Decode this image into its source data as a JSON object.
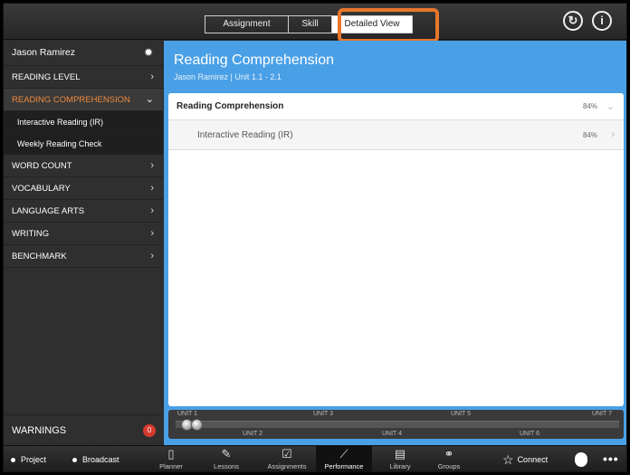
{
  "topbar": {
    "tabs": [
      "Assignment",
      "Skill",
      "Detailed View"
    ],
    "selected_tab": "Detailed View",
    "refresh_icon": "refresh-icon",
    "info_icon": "info-icon",
    "highlight_color": "#e8762c"
  },
  "sidebar": {
    "user_name": "Jason Ramirez",
    "settings_icon": "gear-icon",
    "items": [
      {
        "label": "READING LEVEL",
        "icon": "chevron-right-icon"
      },
      {
        "label": "READING COMPREHENSION",
        "icon": "chevron-down-icon",
        "active": true
      },
      {
        "label": "Interactive Reading (IR)",
        "sub": true
      },
      {
        "label": "Weekly Reading Check",
        "sub": true
      },
      {
        "label": "WORD COUNT",
        "icon": "chevron-right-icon"
      },
      {
        "label": "VOCABULARY",
        "icon": "chevron-right-icon"
      },
      {
        "label": "LANGUAGE ARTS",
        "icon": "chevron-right-icon"
      },
      {
        "label": "WRITING",
        "icon": "chevron-right-icon"
      },
      {
        "label": "BENCHMARK",
        "icon": "chevron-right-icon"
      }
    ],
    "warnings_label": "WARNINGS",
    "warnings_count": "0",
    "active_color": "#f08a3a"
  },
  "main": {
    "title": "Reading Comprehension",
    "subtitle": "Jason Ramirez | Unit 1.1 - 2.1",
    "rows": [
      {
        "label": "Reading Comprehension",
        "value": "84%"
      },
      {
        "label": "Interactive Reading (IR)",
        "value": "84%"
      }
    ],
    "background_color": "#4aa0e6"
  },
  "timeline": {
    "top_labels": [
      "UNIT 1",
      "UNIT 3",
      "UNIT 5",
      "UNIT 7"
    ],
    "bottom_labels": [
      "UNIT 2",
      "UNIT 4",
      "UNIT 6"
    ]
  },
  "bottombar": {
    "left_items": [
      "Project",
      "Broadcast"
    ],
    "tabs": [
      {
        "label": "Planner",
        "icon": "book-icon"
      },
      {
        "label": "Lessons",
        "icon": "edit-icon"
      },
      {
        "label": "Assignments",
        "icon": "checkbox-icon"
      },
      {
        "label": "Performance",
        "icon": "chart-icon"
      },
      {
        "label": "Library",
        "icon": "library-icon"
      },
      {
        "label": "Groups",
        "icon": "groups-icon"
      }
    ],
    "selected_tab": "Performance",
    "connect_label": "Connect"
  }
}
